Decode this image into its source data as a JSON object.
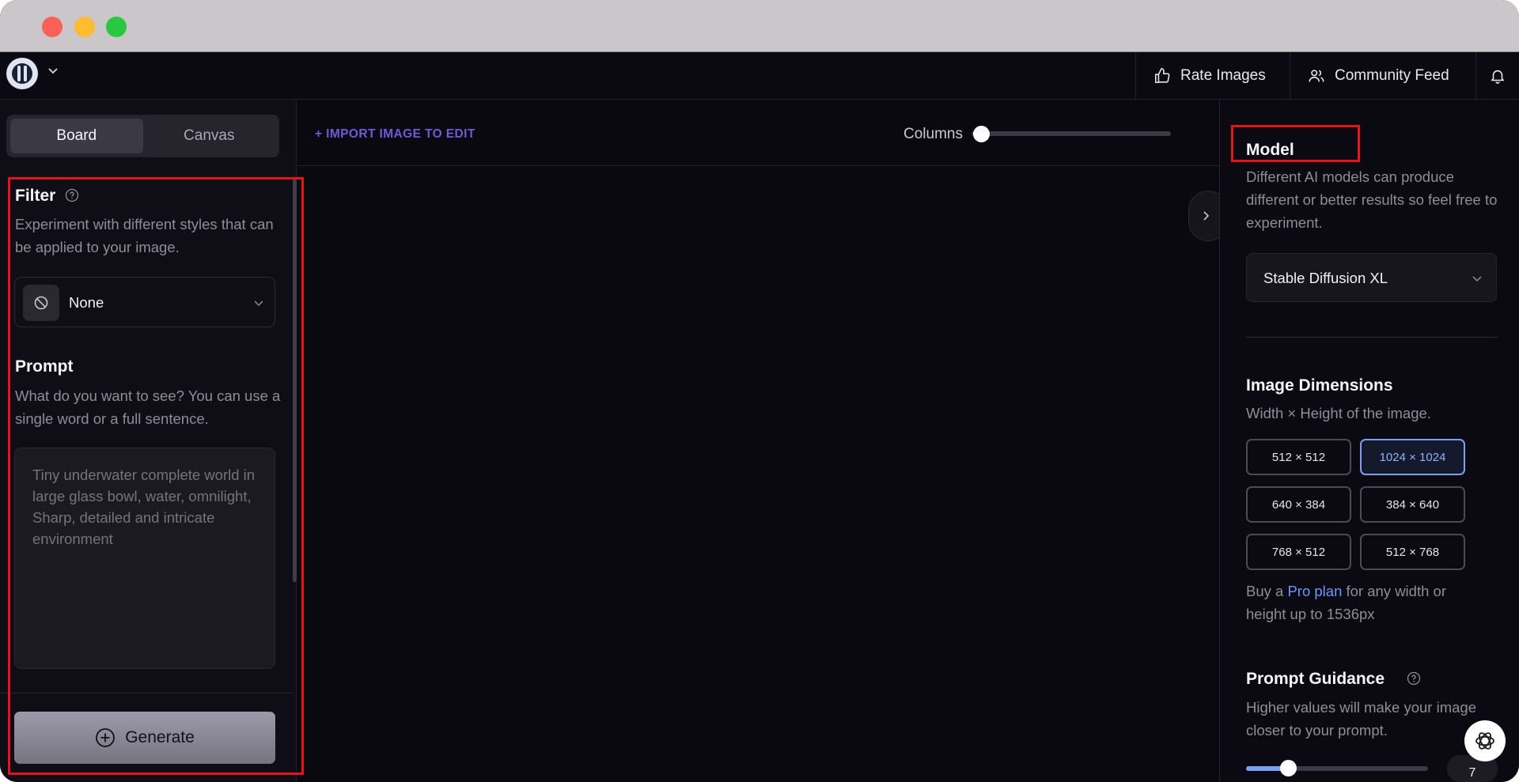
{
  "appbar": {
    "rate_images": "Rate Images",
    "community_feed": "Community Feed"
  },
  "left_panel": {
    "tabs": [
      "Board",
      "Canvas"
    ],
    "filter": {
      "title": "Filter",
      "description": "Experiment with different styles that can be applied to your image.",
      "selected": "None"
    },
    "prompt": {
      "title": "Prompt",
      "description": "What do you want to see? You can use a single word or a full sentence.",
      "placeholder": "Tiny underwater complete world in large glass bowl, water, omnilight, Sharp, detailed and intricate environment"
    },
    "generate_label": "Generate"
  },
  "center": {
    "import_label": "+ IMPORT IMAGE TO EDIT",
    "columns_label": "Columns"
  },
  "right_panel": {
    "model": {
      "title": "Model",
      "description": "Different AI models can produce different or better results so feel free to experiment.",
      "selected": "Stable Diffusion XL"
    },
    "dimensions": {
      "title": "Image Dimensions",
      "description": "Width × Height of the image.",
      "options": [
        "512 × 512",
        "1024 × 1024",
        "640 × 384",
        "384 × 640",
        "768 × 512",
        "512 × 768"
      ],
      "selected": "1024 × 1024",
      "note_prefix": "Buy a ",
      "note_link": "Pro plan",
      "note_suffix": " for any width or height up to 1536px"
    },
    "guidance": {
      "title": "Prompt Guidance",
      "description": "Higher values will make your image closer to your prompt.",
      "value": "7"
    }
  },
  "colors": {
    "accent_purple": "#6d5bd8",
    "accent_blue": "#7d9ff0",
    "highlight_red": "#e6141c",
    "background": "#0a0910"
  }
}
